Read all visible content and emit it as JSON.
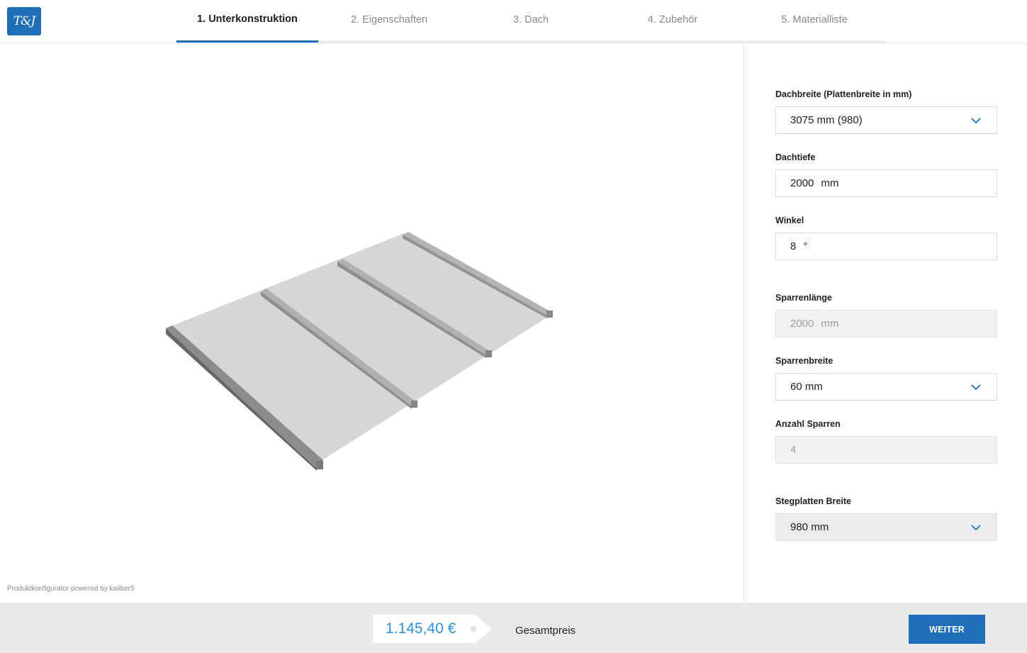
{
  "logo": {
    "text": "T&J"
  },
  "tabs": [
    {
      "label": "1. Unterkonstruktion",
      "active": true
    },
    {
      "label": "2. Eigenschaften",
      "active": false
    },
    {
      "label": "3. Dach",
      "active": false
    },
    {
      "label": "4. Zubehör",
      "active": false
    },
    {
      "label": "5. Materialliste",
      "active": false
    }
  ],
  "viewer": {
    "powered_by": "Produktkonfigurator powered by kaliber5"
  },
  "form": {
    "dachbreite": {
      "label": "Dachbreite (Plattenbreite in mm)",
      "value": "3075 mm (980)"
    },
    "dachtiefe": {
      "label": "Dachtiefe",
      "value": "2000",
      "unit": "mm"
    },
    "winkel": {
      "label": "Winkel",
      "value": "8",
      "unit": "°"
    },
    "sparrenlaenge": {
      "label": "Sparrenlänge",
      "value": "2000",
      "unit": "mm"
    },
    "sparrenbreite": {
      "label": "Sparrenbreite",
      "value": "60 mm"
    },
    "anzahl_sparren": {
      "label": "Anzahl Sparren",
      "value": "4"
    },
    "stegplatten_breite": {
      "label": "Stegplatten Breite",
      "value": "980 mm"
    }
  },
  "footer": {
    "price": "1.145,40 €",
    "total_label": "Gesamtpreis",
    "next_label": "WEITER"
  },
  "colors": {
    "accent": "#1f6eb7",
    "price": "#2e8fd6",
    "footer_bg": "#e9e9e9"
  },
  "icons": {
    "dropdown": "chevron-down-icon"
  }
}
